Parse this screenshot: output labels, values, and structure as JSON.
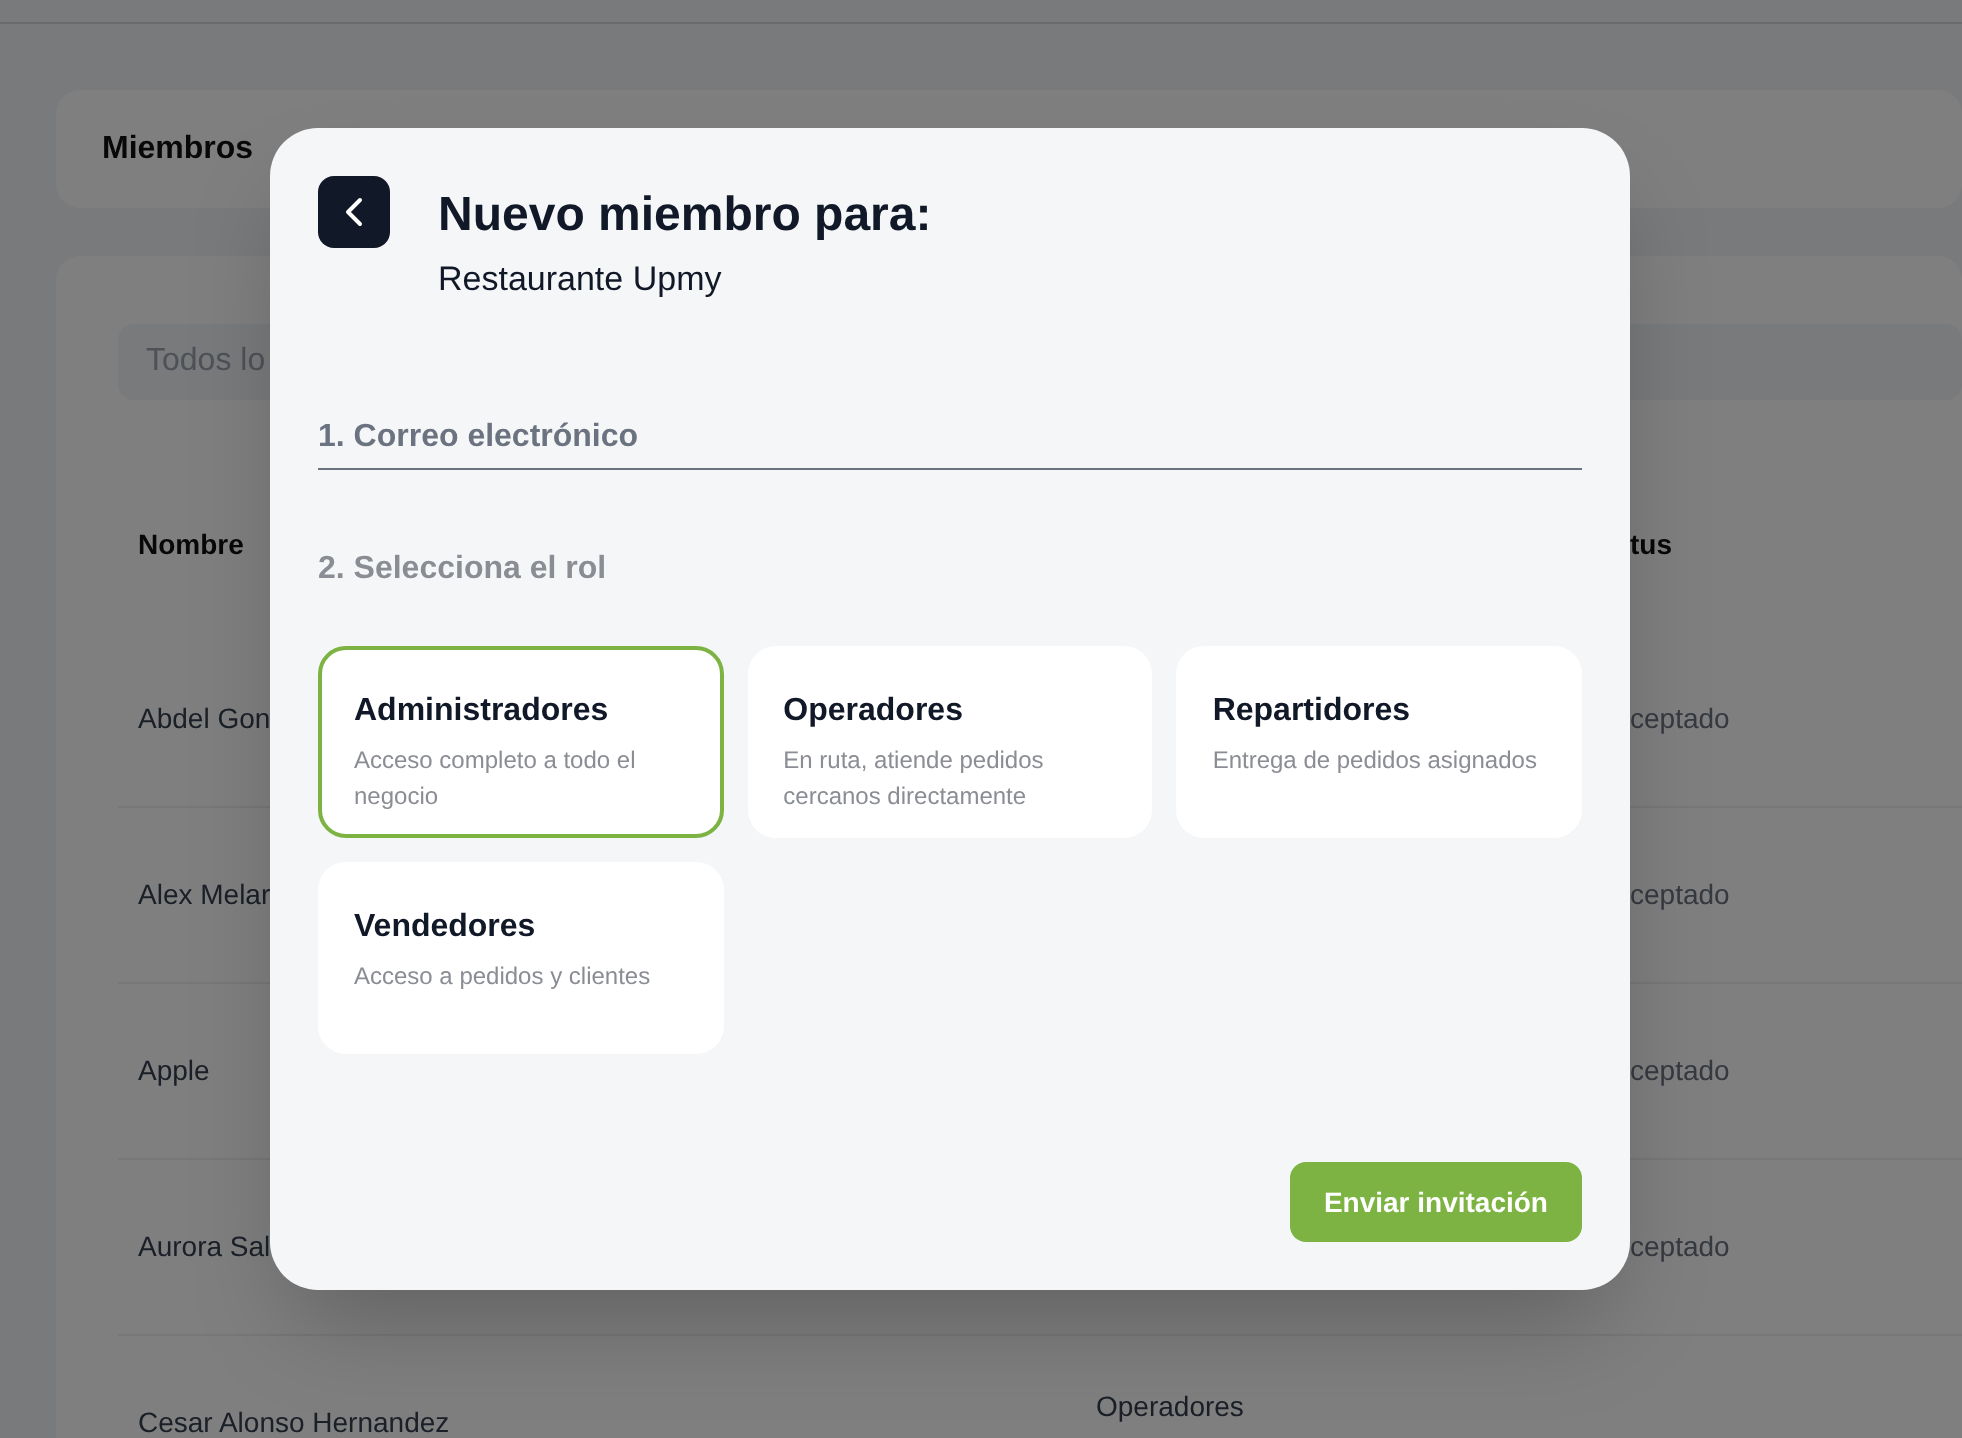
{
  "page": {
    "header_title": "Miembros",
    "search": {
      "placeholder": "Todos lo"
    },
    "table": {
      "columns": [
        "Nombre",
        "tus"
      ],
      "rows": [
        {
          "name": "Abdel Gon",
          "role": "",
          "status": "ceptado"
        },
        {
          "name": "Alex Melar",
          "role": "",
          "status": "ceptado"
        },
        {
          "name": "Apple",
          "role": "",
          "status": "ceptado"
        },
        {
          "name": "Aurora Sal",
          "role": "",
          "status": "ceptado"
        },
        {
          "name": "Cesar Alonso Hernandez",
          "role": "Operadores",
          "status": ""
        }
      ]
    }
  },
  "modal": {
    "title": "Nuevo miembro para:",
    "subtitle": "Restaurante Upmy",
    "email_field": {
      "placeholder": "1. Correo electrónico"
    },
    "role_heading": "2. Selecciona el rol",
    "roles": [
      {
        "name": "Administradores",
        "description": "Acceso completo a todo el negocio",
        "selected": true
      },
      {
        "name": "Operadores",
        "description": "En ruta, atiende pedidos cercanos directamente",
        "selected": false
      },
      {
        "name": "Repartidores",
        "description": "Entrega de pedidos asignados",
        "selected": false
      },
      {
        "name": "Vendedores",
        "description": "Acceso a pedidos y clientes",
        "selected": false
      }
    ],
    "submit_button": "Enviar invitación"
  }
}
